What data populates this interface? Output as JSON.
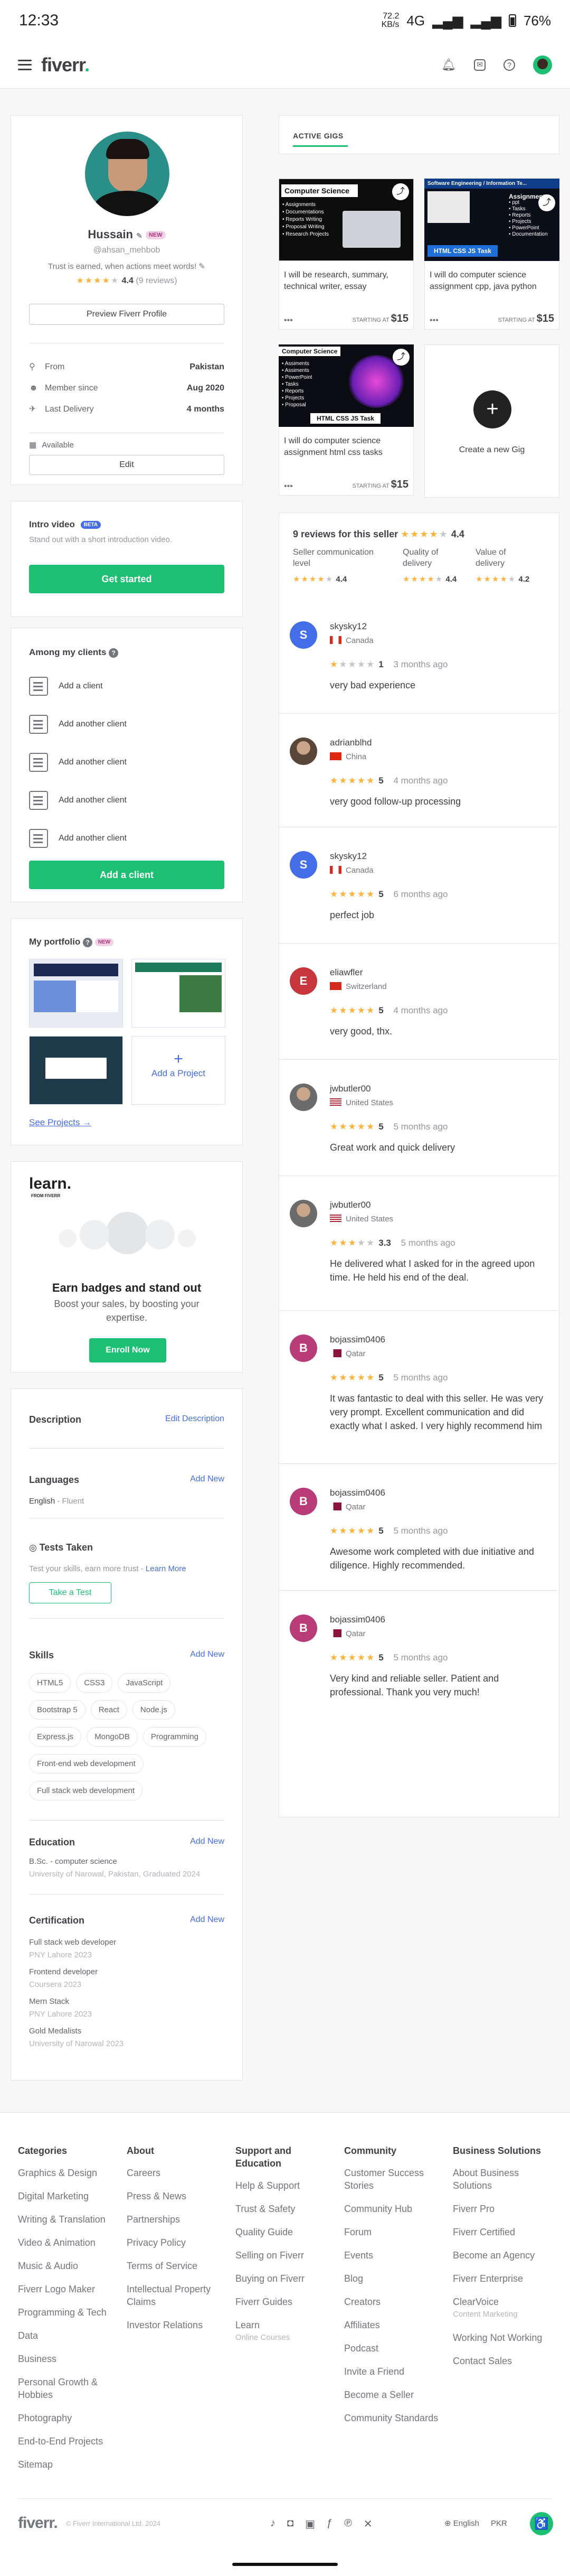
{
  "status": {
    "time": "12:33",
    "speed": "72.2",
    "speed_unit": "KB/s",
    "network": "4G",
    "battery": "76%"
  },
  "nav": {
    "logo_text": "fiverr",
    "logo_dot": "."
  },
  "profile": {
    "name": "Hussain",
    "badge": "NEW",
    "username": "@ahsan_mehbob",
    "tagline": "Trust is earned, when actions meet words!",
    "rating": "4.4",
    "reviews": "(9 reviews)",
    "preview_button": "Preview Fiverr Profile",
    "from_label": "From",
    "from_value": "Pakistan",
    "member_label": "Member since",
    "member_value": "Aug 2020",
    "delivery_label": "Last Delivery",
    "delivery_value": "4 months",
    "availability": "Available",
    "edit_button": "Edit"
  },
  "intro": {
    "title": "Intro video",
    "badge": "BETA",
    "desc": "Stand out with a short introduction video.",
    "button": "Get started"
  },
  "clients": {
    "title": "Among my clients",
    "items": [
      "Add a client",
      "Add another client",
      "Add another client",
      "Add another client",
      "Add another client"
    ],
    "button": "Add a client"
  },
  "portfolio": {
    "title": "My portfolio",
    "badge": "NEW",
    "add_project": "Add a Project",
    "see_projects": "See Projects"
  },
  "learn": {
    "logo": "learn.",
    "logo_sub": "FROM FIVERR",
    "title": "Earn badges and stand out",
    "desc": "Boost your sales, by boosting your expertise.",
    "button": "Enroll Now"
  },
  "details": {
    "description_title": "Description",
    "description_link": "Edit Description",
    "languages_title": "Languages",
    "languages_link": "Add New",
    "language": "English",
    "language_level": "Fluent",
    "tests_title": "Tests Taken",
    "tests_desc": "Test your skills, earn more trust -",
    "tests_link": "Learn More",
    "tests_button": "Take a Test",
    "skills_title": "Skills",
    "skills_link": "Add New",
    "skills": [
      "HTML5",
      "CSS3",
      "JavaScript",
      "Bootstrap 5",
      "React",
      "Node.js",
      "Express.js",
      "MongoDB",
      "Programming",
      "Front-end web development",
      "Full stack web development"
    ],
    "education_title": "Education",
    "education_link": "Add New",
    "education_degree": "B.Sc. - computer science",
    "education_school": "University of Narowal, Pakistan, Graduated 2024",
    "cert_title": "Certification",
    "cert_link": "Add New",
    "certs": [
      {
        "name": "Full stack web developer",
        "org": "PNY Lahore 2023"
      },
      {
        "name": "Frontend developer",
        "org": "Coursera 2023"
      },
      {
        "name": "Mern Stack",
        "org": "PNY Lahore 2023"
      },
      {
        "name": "Gold Medalists",
        "org": "University of Narowal 2023"
      }
    ]
  },
  "gigs": {
    "tab": "ACTIVE GIGS",
    "items": [
      {
        "banner": "Computer Science",
        "lines": [
          "• Assignments",
          "• Documentations",
          "• Reports Writing",
          "• Proposal Writing",
          "• Research Projects"
        ],
        "title": "I will be research, summary, technical writer, essay",
        "starting": "STARTING AT",
        "price": "$15",
        "accent": "#ffffff"
      },
      {
        "banner": "Software Engineering / Information Te...",
        "lines": [
          "Assignments",
          "• ppt",
          "• Tasks",
          "• Reports",
          "• Projects",
          "• PowerPoint",
          "• Documentation"
        ],
        "footer": "HTML CSS JS Task",
        "title": "I will do computer science assignment cpp, java python",
        "starting": "STARTING AT",
        "price": "$15",
        "accent": "#1e6fd9"
      },
      {
        "banner": "Computer Science",
        "lines": [
          "• Assiments",
          "• Assiments",
          "• PowerPoint",
          "• Tasks",
          "• Reports",
          "• Projects",
          "• Proposal"
        ],
        "footer": "HTML CSS JS Task",
        "title": "I will do computer science assignment html css tasks",
        "starting": "STARTING AT",
        "price": "$15",
        "accent": "#9b27c9"
      }
    ],
    "create": "Create a new Gig"
  },
  "reviews": {
    "title": "9 reviews for this seller",
    "overall": "4.4",
    "cat1_label": "Seller communication level",
    "cat1_value": "4.4",
    "cat2_label": "Quality of delivery",
    "cat2_value": "4.4",
    "cat3_label": "Value of delivery",
    "cat3_value": "4.2",
    "items": [
      {
        "name": "skysky12",
        "initial": "S",
        "color": "#446ee7",
        "country": "Canada",
        "stars": "1",
        "full": 1,
        "time": "3 months ago",
        "text": "very bad experience"
      },
      {
        "name": "adrianblhd",
        "initial": "",
        "color": "#5a4638",
        "country": "China",
        "stars": "5",
        "full": 5,
        "time": "4 months ago",
        "text": "very good follow-up processing"
      },
      {
        "name": "skysky12",
        "initial": "S",
        "color": "#446ee7",
        "country": "Canada",
        "stars": "5",
        "full": 5,
        "time": "6 months ago",
        "text": "perfect job"
      },
      {
        "name": "eliawfler",
        "initial": "E",
        "color": "#c7353d",
        "country": "Switzerland",
        "stars": "5",
        "full": 5,
        "time": "4 months ago",
        "text": "very good, thx."
      },
      {
        "name": "jwbutler00",
        "initial": "",
        "color": "#6b6b6b",
        "country": "United States",
        "stars": "5",
        "full": 5,
        "time": "5 months ago",
        "text": "Great work and quick delivery"
      },
      {
        "name": "jwbutler00",
        "initial": "",
        "color": "#6b6b6b",
        "country": "United States",
        "stars": "3.3",
        "full": 3,
        "time": "5 months ago",
        "text": "He delivered what I asked for in the agreed upon time. He held his end of the deal."
      },
      {
        "name": "bojassim0406",
        "initial": "B",
        "color": "#b83c78",
        "country": "Qatar",
        "stars": "5",
        "full": 5,
        "time": "5 months ago",
        "text": "It was fantastic to deal with this seller. He was very very prompt. Excellent communication and did exactly what I asked. I very highly recommend him"
      },
      {
        "name": "bojassim0406",
        "initial": "B",
        "color": "#b83c78",
        "country": "Qatar",
        "stars": "5",
        "full": 5,
        "time": "5 months ago",
        "text": "Awesome work completed with due initiative and diligence. Highly recommended."
      },
      {
        "name": "bojassim0406",
        "initial": "B",
        "color": "#b83c78",
        "country": "Qatar",
        "stars": "5",
        "full": 5,
        "time": "5 months ago",
        "text": "Very kind and reliable seller. Patient and professional. Thank you very much!"
      }
    ]
  },
  "footer": {
    "categories": {
      "title": "Categories",
      "links": [
        "Graphics & Design",
        "Digital Marketing",
        "Writing & Translation",
        "Video & Animation",
        "Music & Audio",
        "Fiverr Logo Maker",
        "Programming & Tech",
        "Data",
        "Business",
        "Personal Growth & Hobbies",
        "Photography",
        "End-to-End Projects",
        "Sitemap"
      ]
    },
    "about": {
      "title": "About",
      "links": [
        "Careers",
        "Press & News",
        "Partnerships",
        "Privacy Policy",
        "Terms of Service",
        "Intellectual Property Claims",
        "Investor Relations"
      ]
    },
    "support": {
      "title": "Support and Education",
      "links": [
        "Help & Support",
        "Trust & Safety",
        "Quality Guide",
        "Selling on Fiverr",
        "Buying on Fiverr",
        "Fiverr Guides",
        "Learn"
      ],
      "learn_sub": "Online Courses"
    },
    "community": {
      "title": "Community",
      "links": [
        "Customer Success Stories",
        "Community Hub",
        "Forum",
        "Events",
        "Blog",
        "Creators",
        "Affiliates",
        "Podcast",
        "Invite a Friend",
        "Become a Seller",
        "Community Standards"
      ]
    },
    "business": {
      "title": "Business Solutions",
      "links": [
        "About Business Solutions",
        "Fiverr Pro",
        "Fiverr Certified",
        "Become an Agency",
        "Fiverr Enterprise",
        "ClearVoice",
        "Working Not Working",
        "Contact Sales"
      ],
      "clearvoice_sub": "Content Marketing"
    },
    "copyright": "© Fiverr International Ltd. 2024",
    "language": "English",
    "currency": "PKR"
  }
}
